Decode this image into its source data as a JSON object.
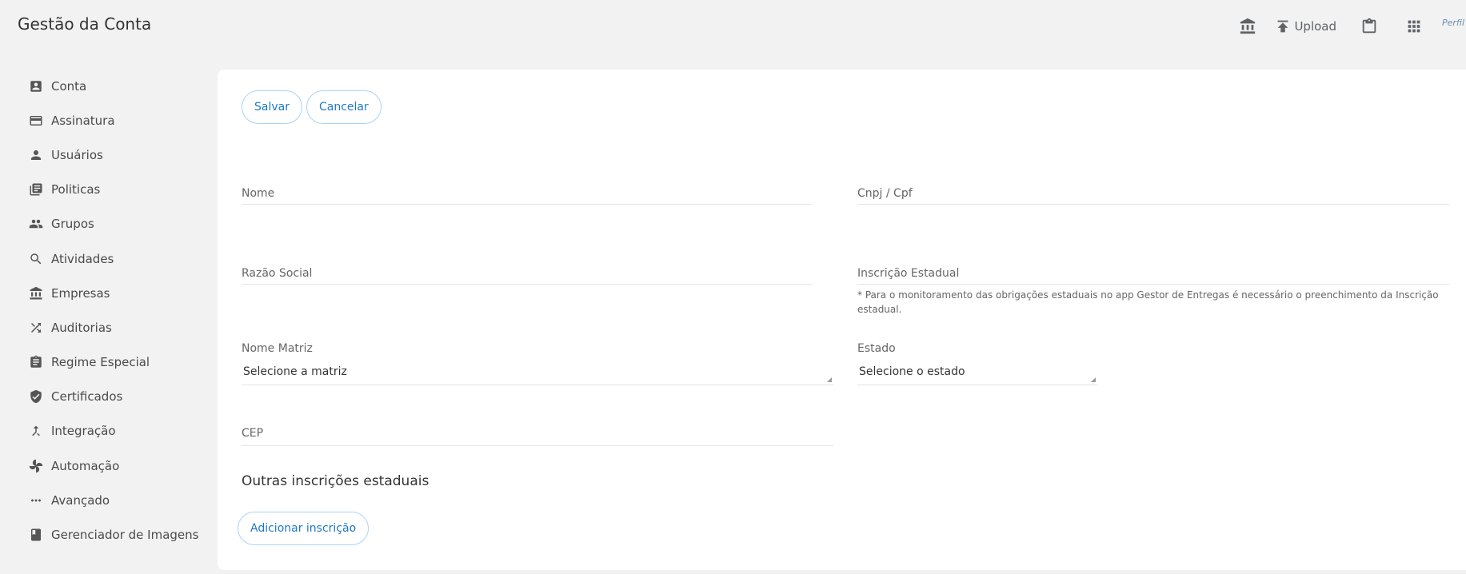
{
  "header": {
    "title": "Gestão da Conta",
    "upload_label": "Upload",
    "avatar_alt": "Perfil",
    "icons": [
      "bank-icon",
      "upload-icon",
      "clipboard-icon",
      "apps-grid-icon",
      "avatar"
    ]
  },
  "sidebar": {
    "items": [
      {
        "label": "Conta",
        "icon": "account-box-icon"
      },
      {
        "label": "Assinatura",
        "icon": "credit-card-icon"
      },
      {
        "label": "Usuários",
        "icon": "person-icon"
      },
      {
        "label": "Politicas",
        "icon": "library-books-icon"
      },
      {
        "label": "Grupos",
        "icon": "group-icon"
      },
      {
        "label": "Atividades",
        "icon": "zoom-search-icon"
      },
      {
        "label": "Empresas",
        "icon": "bank-icon"
      },
      {
        "label": "Auditorias",
        "icon": "shuffle-icon"
      },
      {
        "label": "Regime Especial",
        "icon": "assignment-icon"
      },
      {
        "label": "Certificados",
        "icon": "verified-shield-icon"
      },
      {
        "label": "Integração",
        "icon": "merge-icon"
      },
      {
        "label": "Automação",
        "icon": "fan-icon"
      },
      {
        "label": "Avançado",
        "icon": "more-horiz-icon"
      },
      {
        "label": "Gerenciador de Imagens",
        "icon": "book-icon"
      }
    ]
  },
  "form": {
    "save_label": "Salvar",
    "cancel_label": "Cancelar",
    "nome_label": "Nome",
    "cnpj_label": "Cnpj / Cpf",
    "razao_label": "Razão Social",
    "ie_label": "Inscrição Estadual",
    "ie_hint": "* Para o monitoramento das obrigações estaduais no app Gestor de Entregas é necessário o preenchimento da Inscrição estadual.",
    "matriz_label": "Nome Matriz",
    "matriz_value": "Selecione a matriz",
    "estado_label": "Estado",
    "estado_value": "Selecione o estado",
    "cep_label": "CEP",
    "outras_title": "Outras inscrições estaduais",
    "add_label": "Adicionar inscrição"
  },
  "colors": {
    "accent": "#1e78c8",
    "button_border": "#a9d4f7",
    "background": "#f2f2f2",
    "panel": "#ffffff"
  }
}
